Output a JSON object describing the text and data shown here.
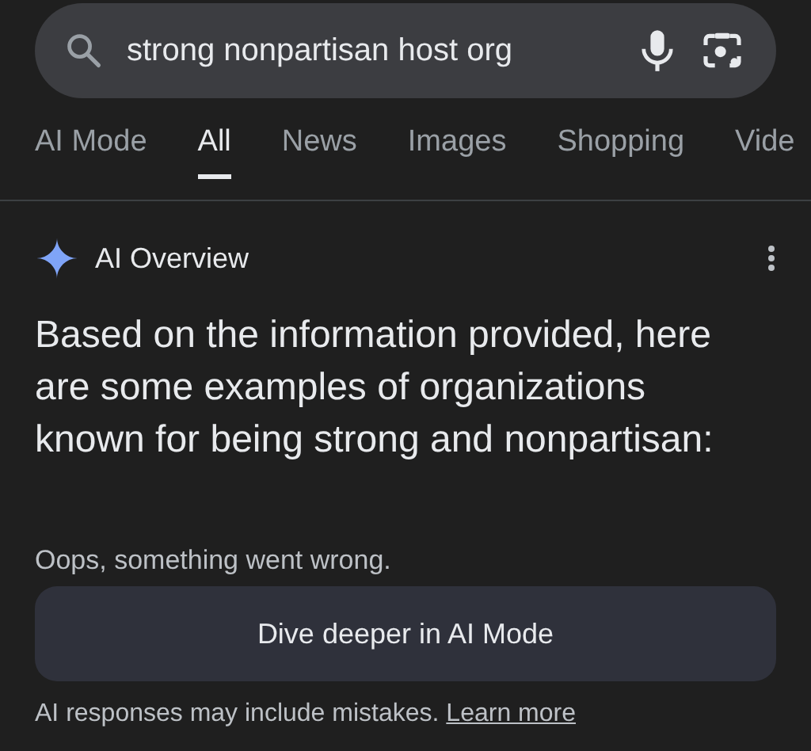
{
  "search": {
    "value": "strong nonpartisan host org"
  },
  "tabs": [
    {
      "label": "AI Mode",
      "selected": false
    },
    {
      "label": "All",
      "selected": true
    },
    {
      "label": "News",
      "selected": false
    },
    {
      "label": "Images",
      "selected": false
    },
    {
      "label": "Shopping",
      "selected": false
    },
    {
      "label": "Vide",
      "selected": false
    }
  ],
  "overview": {
    "title": "AI Overview",
    "summary": "Based on the information provided, here are some examples of organizations known for being strong and nonpartisan:",
    "error": "Oops, something went wrong.",
    "button": "Dive deeper in AI Mode",
    "disclaimer": "AI responses may include mistakes.",
    "link": "Learn more"
  }
}
